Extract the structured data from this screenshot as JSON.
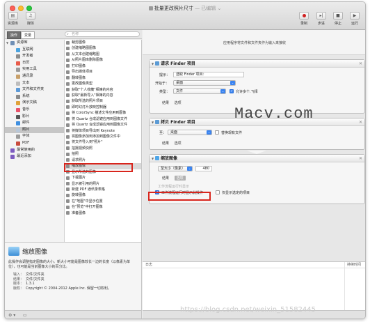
{
  "window": {
    "title": "批量更改照片尺寸",
    "edited": " — 已编辑 ⌄"
  },
  "toolbar": {
    "library": "资源库",
    "media": "媒体",
    "record": "录制",
    "step": "步进",
    "stop": "停止",
    "run": "运行"
  },
  "library": {
    "tab_actions": "操作",
    "tab_variables": "变量",
    "search_placeholder": "名称",
    "categories": [
      {
        "label": "资源库",
        "color": "#6f8fb5"
      },
      {
        "label": "互联网",
        "color": "#4aa3df"
      },
      {
        "label": "开发者",
        "color": "#8c8c8c"
      },
      {
        "label": "日历",
        "color": "#e85b4a"
      },
      {
        "label": "实用工具",
        "color": "#9a9a9a"
      },
      {
        "label": "通讯录",
        "color": "#c8a06a"
      },
      {
        "label": "文本",
        "color": "#bdbdbd"
      },
      {
        "label": "文件和文件夹",
        "color": "#5c9ad8"
      },
      {
        "label": "系统",
        "color": "#8a8a8a"
      },
      {
        "label": "演示文稿",
        "color": "#e0a23a"
      },
      {
        "label": "音乐",
        "color": "#e8526a"
      },
      {
        "label": "影片",
        "color": "#555555"
      },
      {
        "label": "邮件",
        "color": "#3f8fe0"
      },
      {
        "label": "照片",
        "color": "#b8c7d8"
      },
      {
        "label": "字体",
        "color": "#9b9b9b"
      },
      {
        "label": "PDF",
        "color": "#c84b3c"
      },
      {
        "label": "最常使用的",
        "color": "#7d5cc0"
      },
      {
        "label": "最近添加",
        "color": "#7d5cc0"
      }
    ],
    "actions": [
      "裁剪图像",
      "创建缩略图图像",
      "从文本创建缩略图",
      "从照片图库删除图像",
      "打印图像",
      "导出媒体项目",
      "翻转图像",
      "更改图像类型",
      "获取\"个人收藏\"相簿的内容",
      "获取\"最新导入\"相簿的内容",
      "获取所选的照片项目",
      "即时幻灯片放映控制器",
      "将 ColorSync 描述文件应用到图像",
      "将 Quartz 合成滤镜应用到图像文件",
      "将 Quartz 合成滤镜应用到图像文件",
      "将媒体项目导出到 Keynote",
      "将图像添加到添加到图像文件中",
      "将文件导入到\"照片\"",
      "拍摄视频快照",
      "拍照",
      "请求照片",
      "缩放图像",
      "显示所选的图像",
      "下载图片",
      "显示被引用的照片",
      "新建 PDF 通讯录表格",
      "旋转图像",
      "在\"地图\"中显示位置",
      "在\"预览\"中打开图像",
      "准备图像"
    ]
  },
  "description": {
    "title": "缩放图像",
    "text": "此操作会调整指定图像的大小。新大小可能是图像较长一边的长度（以像素为单位），也可能是当前图像大小的百分比。",
    "input_key": "输入：",
    "input_val": "文件/文件夹",
    "result_key": "结果：",
    "result_val": "文件/文件夹",
    "version_key": "版本：",
    "version_val": "1.3.1",
    "copyright_key": "版权：",
    "copyright_val": "Copyright © 2004-2012 Apple Inc. 保留一切权利。"
  },
  "workflow": {
    "header": "应用程序将文件和文件夹作为输入来接收",
    "ask": {
      "title": "请求 Finder 项目",
      "prompt_label": "提示：",
      "prompt_value": "选取 Finder 项目：",
      "start_label": "开始于：",
      "start_value": "桌面",
      "type_label": "类型：",
      "type_value": "文件",
      "multi_label": "允许多个.飞择",
      "result_tab": "结果",
      "options_tab": "选项"
    },
    "copy": {
      "title": "拷贝 Finder 项目",
      "to_label": "至：",
      "to_value": "桌面",
      "replace_label": "替换现有文件",
      "result_tab": "结果",
      "options_tab": "选项"
    },
    "scale": {
      "title": "缩放图像",
      "size_label": "至大小（像素）",
      "size_value": "480",
      "result_tab": "结果",
      "options_tab": "选项",
      "strike_label": "工作流程运行时显示",
      "show_label": "工作流程运行时显示此操作",
      "only_label": "仅显示选定的项目"
    }
  },
  "overlay": {
    "watermark": "Macv.com",
    "csdn": "https://blog.csdn.net/weixin_51582445"
  },
  "log": {
    "col1": "日志",
    "col2": "持续时间"
  },
  "colors": {
    "highlight": "#d8251c",
    "accent": "#3b84f0"
  }
}
